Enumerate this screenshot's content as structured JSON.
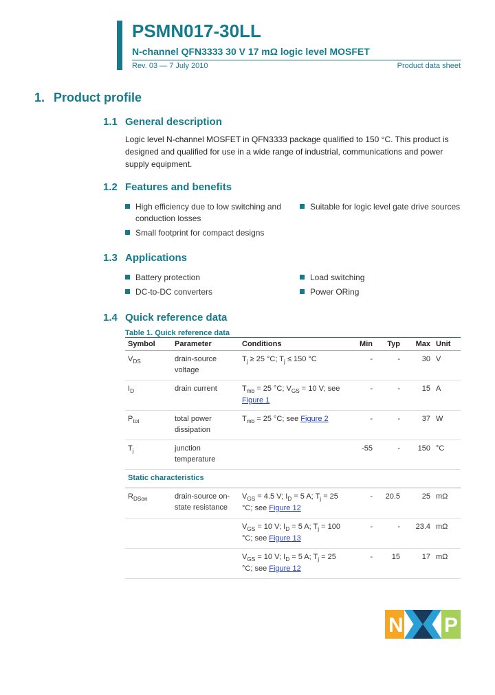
{
  "header": {
    "part_number": "PSMN017-30LL",
    "subtitle": "N-channel QFN3333 30 V 17 mΩ logic level MOSFET",
    "revision": "Rev. 03 — 7 July 2010",
    "doc_type": "Product data sheet"
  },
  "sections": {
    "s1": {
      "num": "1.",
      "title": "Product profile"
    }
  },
  "sub": {
    "s1_1": {
      "num": "1.1",
      "title": "General description",
      "text": "Logic level N-channel MOSFET in QFN3333 package qualified to 150 °C. This product is designed and qualified for use in a wide range of industrial, communications and power supply equipment."
    },
    "s1_2": {
      "num": "1.2",
      "title": "Features and benefits",
      "left": [
        "High efficiency due to low switching and conduction losses",
        "Small footprint for compact designs"
      ],
      "right": [
        "Suitable for logic level gate drive sources"
      ]
    },
    "s1_3": {
      "num": "1.3",
      "title": "Applications",
      "left": [
        "Battery protection",
        "DC-to-DC converters"
      ],
      "right": [
        "Load switching",
        "Power ORing"
      ]
    },
    "s1_4": {
      "num": "1.4",
      "title": "Quick reference data",
      "table_caption": "Table 1.    Quick reference data"
    }
  },
  "table": {
    "headers": [
      "Symbol",
      "Parameter",
      "Conditions",
      "Min",
      "Typ",
      "Max",
      "Unit"
    ],
    "rows": [
      {
        "sym": "V",
        "sub": "DS",
        "param": "drain-source voltage",
        "cond": "T<sub>j</sub> ≥ 25 °C; T<sub>j</sub> ≤ 150 °C",
        "min": "-",
        "typ": "-",
        "max": "30",
        "unit": "V"
      },
      {
        "sym": "I",
        "sub": "D",
        "param": "drain current",
        "cond": "T<sub>mb</sub> = 25 °C; V<sub>GS</sub> = 10 V; see <a class=\"figlink\">Figure 1</a>",
        "min": "-",
        "typ": "-",
        "max": "15",
        "unit": "A"
      },
      {
        "sym": "P",
        "sub": "tot",
        "param": "total power dissipation",
        "cond": "T<sub>mb</sub> = 25 °C; see <a class=\"figlink\">Figure 2</a>",
        "min": "-",
        "typ": "-",
        "max": "37",
        "unit": "W"
      },
      {
        "sym": "T",
        "sub": "j",
        "param": "junction temperature",
        "cond": "",
        "min": "-55",
        "typ": "-",
        "max": "150",
        "unit": "°C"
      }
    ],
    "subhead": "Static characteristics",
    "rows2": [
      {
        "sym": "R",
        "sub": "DSon",
        "param": "drain-source on-state resistance",
        "cond": "V<sub>GS</sub> = 4.5 V; I<sub>D</sub> = 5 A; T<sub>j</sub> = 25 °C; see <a class=\"figlink\">Figure 12</a>",
        "min": "-",
        "typ": "20.5",
        "max": "25",
        "unit": "mΩ"
      },
      {
        "sym": "",
        "sub": "",
        "param": "",
        "cond": "V<sub>GS</sub> = 10 V; I<sub>D</sub> = 5 A; T<sub>j</sub> = 100 °C; see <a class=\"figlink\">Figure 13</a>",
        "min": "-",
        "typ": "-",
        "max": "23.4",
        "unit": "mΩ"
      },
      {
        "sym": "",
        "sub": "",
        "param": "",
        "cond": "V<sub>GS</sub> = 10 V; I<sub>D</sub> = 5 A; T<sub>j</sub> = 25 °C; see <a class=\"figlink\">Figure 12</a>",
        "min": "-",
        "typ": "15",
        "max": "17",
        "unit": "mΩ"
      }
    ]
  }
}
